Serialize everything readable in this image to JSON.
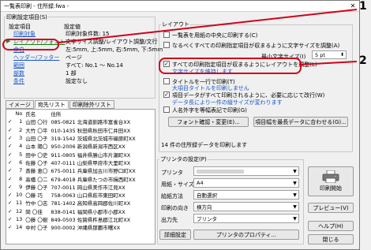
{
  "window": {
    "title": "一覧表印刷 - 住所録.fwa -"
  },
  "left": {
    "group_title": "印刷設定項目(S)",
    "header_item": "設定項目",
    "header_value": "設定値",
    "items": [
      {
        "label": "印刷対象",
        "value": "印刷対象件数: 15"
      },
      {
        "label": "レイアウト/フォント",
        "value": "文字サイズ調整/レイアウト調整/文行"
      },
      {
        "label": "余白",
        "value": "左:5mm, 上:5mm, 右:5mm, 下:5mm"
      },
      {
        "label": "ヘッダー/フッター",
        "value": "ページ"
      },
      {
        "label": "範囲",
        "value": "すべて: No.1 〜 No.14"
      },
      {
        "label": "部数",
        "value": "1 部"
      },
      {
        "label": "条件",
        "value": "設定なし"
      }
    ],
    "tabs": [
      "イメージ",
      "宛先リスト",
      "印刷除外リスト"
    ],
    "list_headers": [
      "No",
      "氏名",
      "住所"
    ],
    "rows": [
      {
        "no": "1",
        "name": "山田 〇行",
        "addr": "085-0821 北海道釧路市富雀台XX"
      },
      {
        "no": "2",
        "name": "大竹 〇平",
        "addr": "010-1435 秋田県秋田市仁井田XX"
      },
      {
        "no": "3",
        "name": "山田 〇子",
        "addr": "319-1542 茨城県北茨城市磯原町XX"
      },
      {
        "no": "4",
        "name": "山本 陽〇",
        "addr": "950-2006 新潟県新潟市西区XX"
      },
      {
        "no": "5",
        "name": "田中 〇史",
        "addr": "911-0805 福井県勝山市片瀬町XX"
      },
      {
        "no": "6",
        "name": "佐藤 〇子",
        "addr": "407-0111 山梨県甲府市大里町XX"
      },
      {
        "no": "7",
        "name": "斎藤 恵〇",
        "addr": "675-0011 兵庫県加古川市野口町XX"
      },
      {
        "no": "8",
        "name": "高橋 〇二",
        "addr": "679-4018 兵庫県たつの市揖西町XX"
      },
      {
        "no": "9",
        "name": "伊藤 〇子",
        "addr": "707-0011 岡山県美作市江見XX"
      },
      {
        "no": "10",
        "name": "〇藤 巧",
        "addr": "758-0063 山口県萩市東田町XX"
      },
      {
        "no": "11",
        "name": "竹中 〇志",
        "addr": "781-1402 高知県高岡郡佐川町XX"
      },
      {
        "no": "12",
        "name": "岡 〇佳",
        "addr": "838-0141 福岡県小郡市小郡XX"
      },
      {
        "no": "13",
        "name": "〇藤 〇樹",
        "addr": "849-0503 佐賀県杵島郡江北町XX"
      },
      {
        "no": "14",
        "name": "中村 〇子",
        "addr": "900-0002 沖縄県那覇市曙XX"
      }
    ]
  },
  "right": {
    "group_title": "レイアウト",
    "opt1": "一覧表を用紙の中央に印刷する(C)",
    "opt2": "なるべくすべての印刷指定項目が収まるように文字サイズを調整(A)",
    "min_size_label": "最小文字サイズ(I)",
    "min_size_value": "5 pt",
    "opt3": "すべての印刷指定項目が収まるようにレイアウトを調整(L)",
    "opt3_note": "文字サイズを維持します",
    "opt4": "タイトルを一行で印刷(T)",
    "opt4_note": "大項目タイトルを印刷しません",
    "opt5": "項目データがすべて印刷されるように、必要に応じて改行(W)",
    "opt5_note": "データ長により一件の縦サイズが変わります",
    "opt6": "人名外字を等幅表記で印刷(G)",
    "font_btn": "フォント確認・変更(E)...",
    "fit_btn": "項目幅を最長データに合わせる(G)...",
    "status": "14 件の住所録データを印刷します",
    "printer_group": "プリンタの設定(P)",
    "printer_label": "プリンタ",
    "printer_value": "",
    "paper_label": "用紙・サイズ",
    "paper_value": "A4",
    "feed_label": "給紙方法",
    "feed_value": "自動選択",
    "orient_label": "印刷の向き",
    "orient_value": "横方向",
    "output_label": "出力先",
    "output_value": "プリンタ",
    "detail_btn": "詳細設定",
    "props_btn": "プリンタのプロパティ...",
    "print_btn": "印刷開始",
    "preview_btn": "プレビュー(V)",
    "help_btn": "ヘルプ(H)",
    "close_btn": "閉じる"
  },
  "annotations": {
    "one": "1",
    "two": "2"
  }
}
